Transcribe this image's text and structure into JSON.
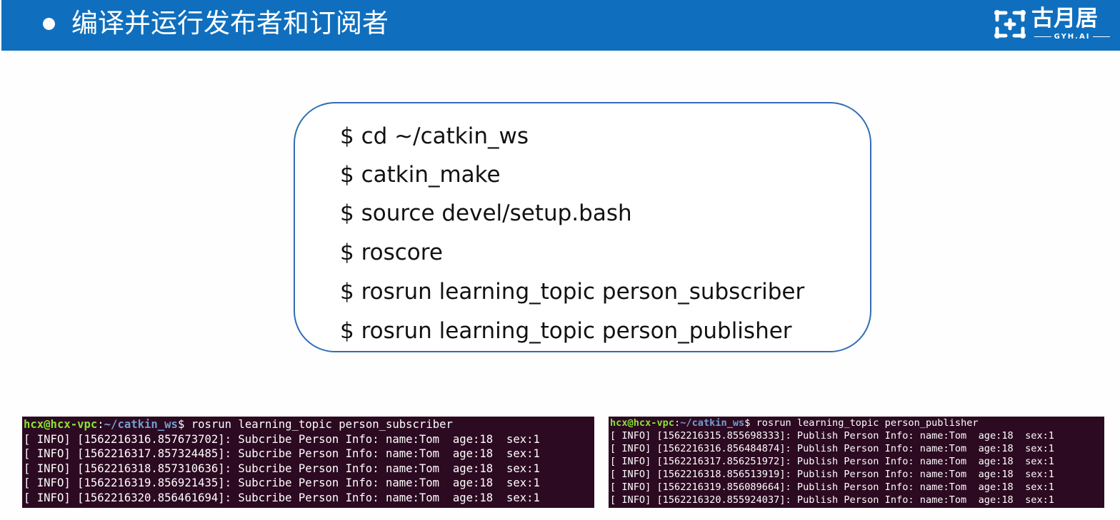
{
  "header": {
    "title": "编译并运行发布者和订阅者",
    "background_color": "#0f6fbe"
  },
  "logo": {
    "name": "古月居",
    "sub": "GYH.AI",
    "icon": "gyh-logo-icon"
  },
  "commands": [
    "$ cd ~/catkin_ws",
    "$ catkin_make",
    "$ source devel/setup.bash",
    "$ roscore",
    "$ rosrun learning_topic person_subscriber",
    "$ rosrun learning_topic person_publisher"
  ],
  "terminal_subscriber": {
    "prompt_user": "hcx@hcx-vpc",
    "prompt_sep": ":",
    "prompt_path": "~/catkin_ws",
    "prompt_cmd": "$ rosrun learning_topic person_subscriber",
    "lines": [
      "[ INFO] [1562216316.857673702]: Subcribe Person Info: name:Tom  age:18  sex:1",
      "[ INFO] [1562216317.857324485]: Subcribe Person Info: name:Tom  age:18  sex:1",
      "[ INFO] [1562216318.857310636]: Subcribe Person Info: name:Tom  age:18  sex:1",
      "[ INFO] [1562216319.856921435]: Subcribe Person Info: name:Tom  age:18  sex:1",
      "[ INFO] [1562216320.856461694]: Subcribe Person Info: name:Tom  age:18  sex:1"
    ]
  },
  "terminal_publisher": {
    "prompt_user": "hcx@hcx-vpc",
    "prompt_sep": ":",
    "prompt_path": "~/catkin_ws",
    "prompt_cmd": "$ rosrun learning_topic person_publisher",
    "lines": [
      "[ INFO] [1562216315.855698333]: Publish Person Info: name:Tom  age:18  sex:1",
      "[ INFO] [1562216316.856484874]: Publish Person Info: name:Tom  age:18  sex:1",
      "[ INFO] [1562216317.856251972]: Publish Person Info: name:Tom  age:18  sex:1",
      "[ INFO] [1562216318.856513919]: Publish Person Info: name:Tom  age:18  sex:1",
      "[ INFO] [1562216319.856089664]: Publish Person Info: name:Tom  age:18  sex:1",
      "[ INFO] [1562216320.855924037]: Publish Person Info: name:Tom  age:18  sex:1"
    ]
  },
  "colors": {
    "terminal_bg": "#2c0a21",
    "prompt_user": "#8ae234",
    "prompt_path": "#729fcf",
    "box_border": "#2f6db5"
  }
}
